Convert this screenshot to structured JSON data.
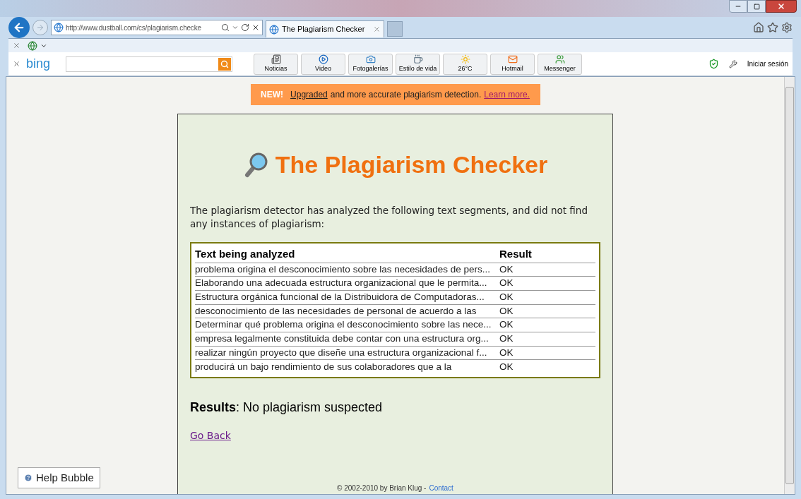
{
  "browser": {
    "address": "http://www.dustball.com/cs/plagiarism.checke",
    "tabs": [
      {
        "label": "The Plagiarism Checker",
        "selected": true
      }
    ]
  },
  "bing_bar": {
    "logo": "bing",
    "buttons": [
      "Noticias",
      "Video",
      "Fotogalerías",
      "Estilo de vida",
      "26°C",
      "Hotmail",
      "Messenger"
    ],
    "sign_in": "Iniciar sesión"
  },
  "banner": {
    "badge": "NEW!",
    "link": "Upgraded",
    "text": "and more accurate plagiarism detection.",
    "learn_more": "Learn more."
  },
  "page": {
    "title": "The Plagiarism Checker",
    "intro": "The plagiarism detector has analyzed the following text segments, and did not find any instances of plagiarism:",
    "table": {
      "columns": [
        "Text being analyzed",
        "Result"
      ],
      "rows": [
        {
          "text": "problema origina el desconocimiento sobre las necesidades de pers...",
          "result": "OK"
        },
        {
          "text": "Elaborando una adecuada estructura organizacional que le permita...",
          "result": "OK"
        },
        {
          "text": "Estructura orgánica funcional de la Distribuidora de Computadoras...",
          "result": "OK"
        },
        {
          "text": "desconocimiento de las necesidades de personal de acuerdo a las",
          "result": "OK"
        },
        {
          "text": "Determinar qué problema origina el desconocimiento sobre las nece...",
          "result": "OK"
        },
        {
          "text": "empresa legalmente constituida debe contar con una estructura org...",
          "result": "OK"
        },
        {
          "text": "realizar ningún proyecto que diseñe una estructura organizacional f...",
          "result": "OK"
        },
        {
          "text": "producirá un bajo rendimiento de sus colaboradores que a la",
          "result": "OK"
        }
      ]
    },
    "results_label": "Results",
    "results_text": ": No plagiarism suspected",
    "go_back": "Go Back",
    "footer": "© 2002-2010 by Brian Klug -",
    "contact": "Contact"
  },
  "help_bubble": "Help Bubble"
}
